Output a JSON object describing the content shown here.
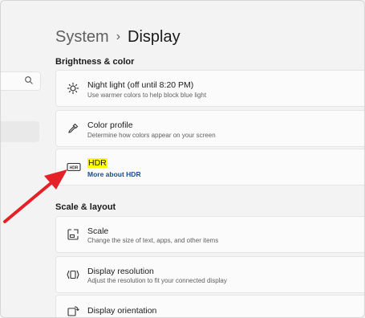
{
  "header": {
    "parent": "System",
    "separator": "›",
    "current": "Display"
  },
  "search": {
    "placeholder": "",
    "icon": "search-icon"
  },
  "sections": {
    "brightness": "Brightness & color",
    "scale": "Scale & layout"
  },
  "items": {
    "night_light": {
      "title": "Night light (off until 8:20 PM)",
      "desc": "Use warmer colors to help block blue light",
      "icon": "brightness-icon"
    },
    "color_profile": {
      "title": "Color profile",
      "desc": "Determine how colors appear on your screen",
      "icon": "eyedropper-icon"
    },
    "hdr": {
      "title": "HDR",
      "link": "More about HDR",
      "icon": "hdr-icon"
    },
    "scale": {
      "title": "Scale",
      "desc": "Change the size of text, apps, and other items",
      "icon": "scale-icon"
    },
    "resolution": {
      "title": "Display resolution",
      "desc": "Adjust the resolution to fit your connected display",
      "icon": "resolution-icon"
    },
    "orientation": {
      "title": "Display orientation",
      "icon": "orientation-icon"
    }
  },
  "colors": {
    "annotation_arrow": "#e32126",
    "highlight": "#ffff00",
    "link": "#1a4c8b"
  }
}
